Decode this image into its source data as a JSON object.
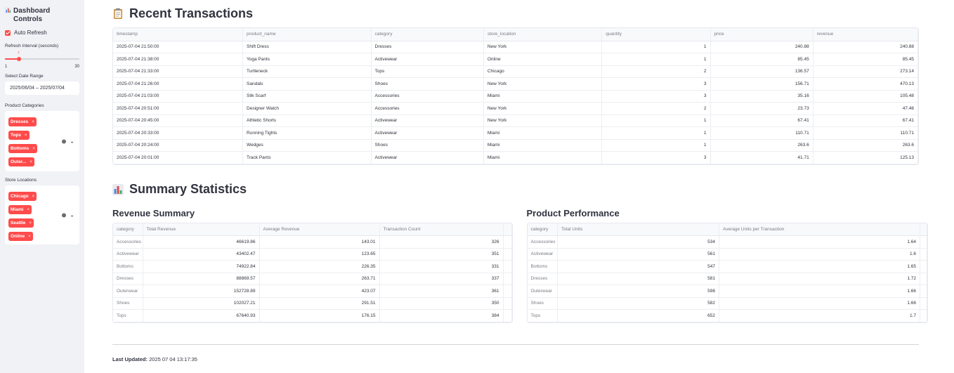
{
  "sidebar": {
    "title": "Dashboard Controls",
    "auto_refresh_label": "Auto Refresh",
    "refresh_interval_label": "Refresh Interval (seconds)",
    "refresh_value": "7",
    "refresh_min": "1",
    "refresh_max": "30",
    "refresh_fraction": 0.207,
    "date_range_label": "Select Date Range",
    "date_range_value": "2025/06/04 – 2025/07/04",
    "categories_label": "Product Categories",
    "categories": [
      "Dresses",
      "Tops",
      "Bottoms",
      "Outer..."
    ],
    "store_label": "Store Locations",
    "stores": [
      "Chicago",
      "Miami",
      "Seattle",
      "Online"
    ]
  },
  "recent": {
    "title": "Recent Transactions",
    "columns": [
      "timestamp",
      "product_name",
      "category",
      "store_location",
      "quantity",
      "price",
      "revenue"
    ],
    "rows": [
      [
        "2025-07-04 21:50:00",
        "Shift Dress",
        "Dresses",
        "New York",
        "1",
        "240.88",
        "240.88"
      ],
      [
        "2025-07-04 21:38:00",
        "Yoga Pants",
        "Activewear",
        "Online",
        "1",
        "85.45",
        "85.45"
      ],
      [
        "2025-07-04 21:33:00",
        "Turtleneck",
        "Tops",
        "Chicago",
        "2",
        "136.57",
        "273.14"
      ],
      [
        "2025-07-04 21:26:00",
        "Sandals",
        "Shoes",
        "New York",
        "3",
        "156.71",
        "470.13"
      ],
      [
        "2025-07-04 21:03:00",
        "Silk Scarf",
        "Accessories",
        "Miami",
        "3",
        "35.16",
        "105.48"
      ],
      [
        "2025-07-04 20:51:00",
        "Designer Watch",
        "Accessories",
        "New York",
        "2",
        "23.73",
        "47.46"
      ],
      [
        "2025-07-04 20:45:00",
        "Athletic Shorts",
        "Activewear",
        "New York",
        "1",
        "67.41",
        "67.41"
      ],
      [
        "2025-07-04 20:33:00",
        "Running Tights",
        "Activewear",
        "Miami",
        "1",
        "110.71",
        "110.71"
      ],
      [
        "2025-07-04 20:24:00",
        "Wedges",
        "Shoes",
        "Miami",
        "1",
        "263.6",
        "263.6"
      ],
      [
        "2025-07-04 20:01:00",
        "Track Pants",
        "Activewear",
        "Miami",
        "3",
        "41.71",
        "125.13"
      ]
    ]
  },
  "summary": {
    "title": "Summary Statistics",
    "revenue_title": "Revenue Summary",
    "revenue_columns": [
      "category",
      "Total Revenue",
      "Average Revenue",
      "Transaction Count"
    ],
    "revenue_rows": [
      [
        "Accessories",
        "46619.86",
        "143.01",
        "326"
      ],
      [
        "Activewear",
        "43402.47",
        "123.65",
        "351"
      ],
      [
        "Bottoms",
        "74922.84",
        "226.35",
        "331"
      ],
      [
        "Dresses",
        "88869.57",
        "263.71",
        "337"
      ],
      [
        "Outerwear",
        "152728.89",
        "423.07",
        "361"
      ],
      [
        "Shoes",
        "102027.21",
        "291.51",
        "350"
      ],
      [
        "Tops",
        "67640.93",
        "176.15",
        "384"
      ]
    ],
    "product_title": "Product Performance",
    "product_columns": [
      "category",
      "Total Units",
      "Average Units per Transaction"
    ],
    "product_rows": [
      [
        "Accessories",
        "534",
        "1.64"
      ],
      [
        "Activewear",
        "561",
        "1.6"
      ],
      [
        "Bottoms",
        "547",
        "1.65"
      ],
      [
        "Dresses",
        "581",
        "1.72"
      ],
      [
        "Outerwear",
        "598",
        "1.66"
      ],
      [
        "Shoes",
        "582",
        "1.66"
      ],
      [
        "Tops",
        "652",
        "1.7"
      ]
    ]
  },
  "footer": {
    "updated_label": "Last Updated:",
    "updated_value": "2025 07 04 13:17:35"
  }
}
